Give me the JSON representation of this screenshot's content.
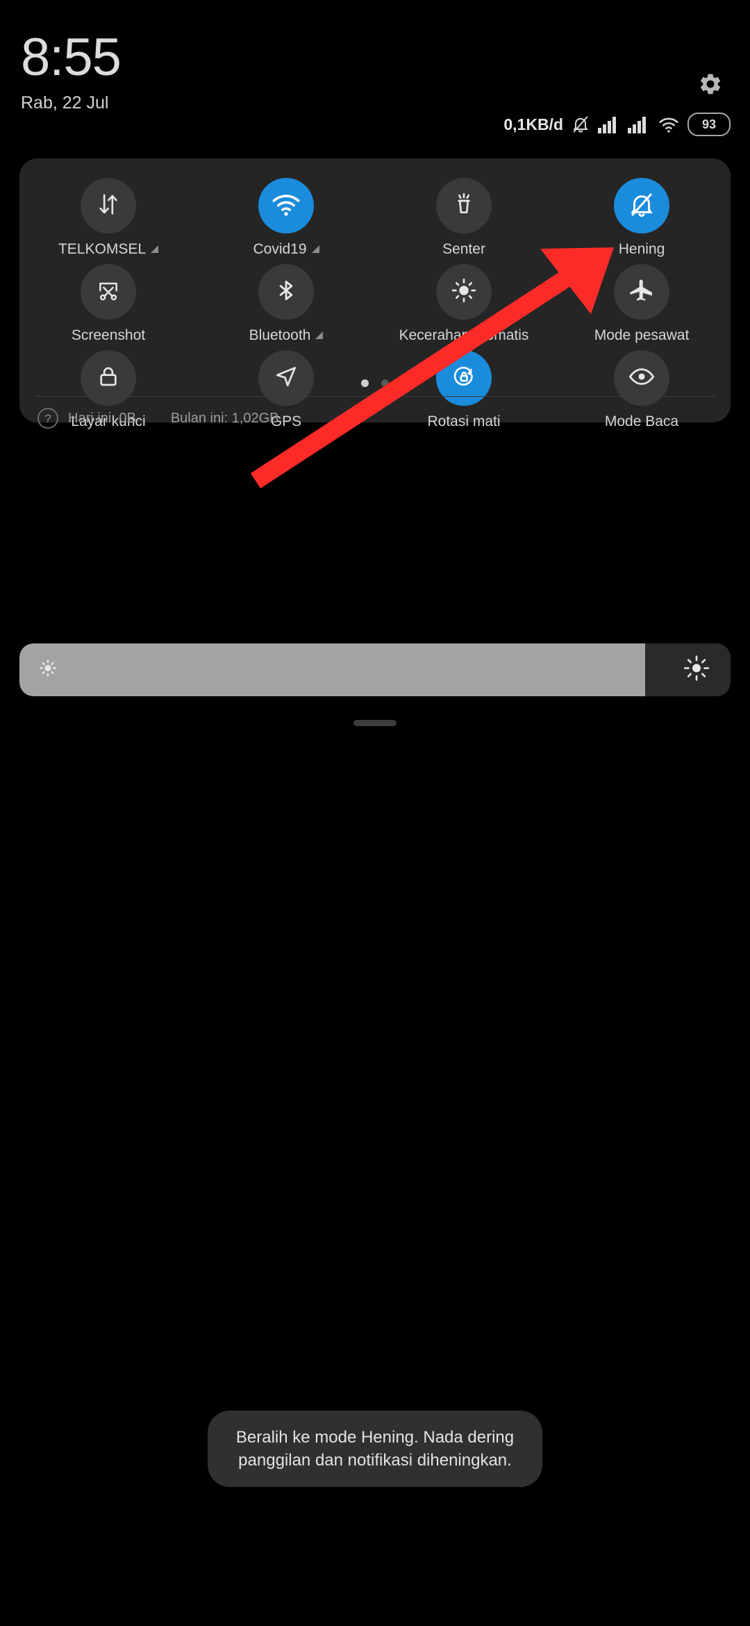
{
  "clock": {
    "time": "8:55",
    "date": "Rab, 22 Jul"
  },
  "statusbar": {
    "net_speed": "0,1KB/d",
    "silent_icon": "bell-slash-icon",
    "signal1_icon": "signal-bars-icon",
    "signal2_icon": "signal-bars-icon",
    "wifi_icon": "wifi-icon",
    "battery_level": "93"
  },
  "header": {
    "settings_icon": "gear-icon"
  },
  "quick_settings": {
    "tiles": [
      {
        "label": "TELKOMSEL",
        "icon": "mobile-data-icon",
        "active": false,
        "expandable": true
      },
      {
        "label": "Covid19",
        "icon": "wifi-icon",
        "active": true,
        "expandable": true
      },
      {
        "label": "Senter",
        "icon": "flashlight-icon",
        "active": false,
        "expandable": false
      },
      {
        "label": "Hening",
        "icon": "bell-slash-icon",
        "active": true,
        "expandable": false
      },
      {
        "label": "Screenshot",
        "icon": "screenshot-scissors-icon",
        "active": false,
        "expandable": false
      },
      {
        "label": "Bluetooth",
        "icon": "bluetooth-icon",
        "active": false,
        "expandable": true
      },
      {
        "label": "Kecerahan otomatis",
        "icon": "auto-brightness-icon",
        "active": false,
        "expandable": false
      },
      {
        "label": "Mode pesawat",
        "icon": "airplane-icon",
        "active": false,
        "expandable": false
      },
      {
        "label": "Layar kunci",
        "icon": "lock-icon",
        "active": false,
        "expandable": false
      },
      {
        "label": "GPS",
        "icon": "location-arrow-icon",
        "active": false,
        "expandable": false
      },
      {
        "label": "Rotasi mati",
        "icon": "rotation-lock-icon",
        "active": true,
        "expandable": false
      },
      {
        "label": "Mode Baca",
        "icon": "eye-icon",
        "active": false,
        "expandable": false
      }
    ],
    "pages": {
      "count": 2,
      "current": 1
    },
    "data_usage": {
      "help_icon": "question-mark-icon",
      "today": "Hari ini: 0B",
      "month": "Bulan ini: 1,02GB"
    }
  },
  "brightness": {
    "value_percent": 88,
    "low_icon": "brightness-low-icon",
    "high_icon": "brightness-high-icon"
  },
  "toast": {
    "message": "Beralih ke mode Hening. Nada dering panggilan dan notifikasi diheningkan."
  },
  "annotation": {
    "arrow_color": "#FC2B28",
    "points_to": "Hening"
  },
  "colors": {
    "accent": "#1b8bdc",
    "panel_bg": "#252525",
    "tile_off_bg": "#3a3a3a",
    "screen_bg": "#000000"
  }
}
